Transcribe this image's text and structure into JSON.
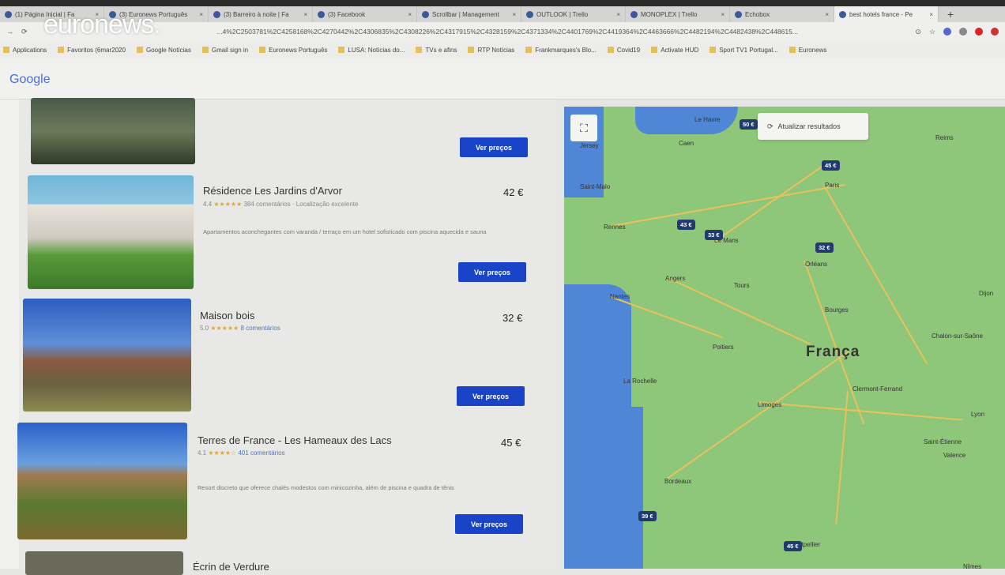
{
  "overlay": {
    "brand": "euronews."
  },
  "browser": {
    "tabs": [
      {
        "label": "(1) Página Inicial | Fa"
      },
      {
        "label": "(3) Euronews Português"
      },
      {
        "label": "(3) Barreiro à noite | Fa"
      },
      {
        "label": "(3) Facebook"
      },
      {
        "label": "Scrollbar | Management"
      },
      {
        "label": "OUTLOOK | Trello"
      },
      {
        "label": "MONOPLEX | Trello"
      },
      {
        "label": "Echobox"
      },
      {
        "label": "best hotels france - Pe"
      }
    ],
    "new_tab": "+",
    "url": "...4%2C2503781%2C4258168%2C4270442%2C4306835%2C4308226%2C4317915%2C4328159%2C4371334%2C4401769%2C4419364%2C4463666%2C4482194%2C4482438%2C448615...",
    "bookmarks": [
      "Applications",
      "Favoritos (6mar2020",
      "Google Notícias",
      "Gmail sign in",
      "Euronews Português",
      "LUSA: Notícias do...",
      "TVs e afins",
      "RTP Notícias",
      "Frankmarques's Blo...",
      "Covid19",
      "Activate HUD",
      "Sport TV1 Portugal...",
      "Euronews"
    ]
  },
  "header": {
    "logo": "Google"
  },
  "hotels": [
    {
      "name": "",
      "button": "Ver preços"
    },
    {
      "name": "Résidence Les Jardins d'Arvor",
      "rating": "4.4",
      "stars": "★★★★★",
      "reviews": "384 comentários",
      "extra": "· Localização excelente",
      "description": "Apartamentos aconchegantes com varanda / terraço em um hotel sofisticado com piscina aquecida e sauna",
      "price": "42 €",
      "button": "Ver preços"
    },
    {
      "name": "Maison bois",
      "rating": "5.0",
      "stars": "★★★★★",
      "reviews": "8 comentários",
      "price": "32 €",
      "button": "Ver preços"
    },
    {
      "name": "Terres de France - Les Hameaux des Lacs",
      "rating": "4.1",
      "stars": "★★★★☆",
      "reviews": "401 comentários",
      "description": "Resort discreto que oferece chalés modestos com minicozinha, além de piscina e quadra de tênis",
      "price": "45 €",
      "button": "Ver preços"
    },
    {
      "name": "Écrin de Verdure"
    }
  ],
  "map": {
    "refresh": "Atualizar resultados",
    "country": "França",
    "cities": [
      "Le Havre",
      "Caen",
      "Jersey",
      "Saint-Malo",
      "Rennes",
      "Nantes",
      "Angers",
      "Tours",
      "Orléans",
      "Le Mans",
      "Poitiers",
      "La Rochelle",
      "Limoges",
      "Bordeaux",
      "Bourges",
      "Clermont-Ferrand",
      "Lyon",
      "Dijon",
      "Reims",
      "Paris",
      "Montpellier",
      "Nîmes",
      "Valence",
      "Saint-Étienne",
      "Chalon-sur-Saône"
    ],
    "pins": [
      "50 €",
      "45 €",
      "43 €",
      "33 €",
      "32 €",
      "39 €",
      "45 €"
    ]
  },
  "colors": {
    "button": "#1a44c8",
    "pin": "#233a6e",
    "land": "#8fc77a",
    "sea": "#4f86d6"
  }
}
